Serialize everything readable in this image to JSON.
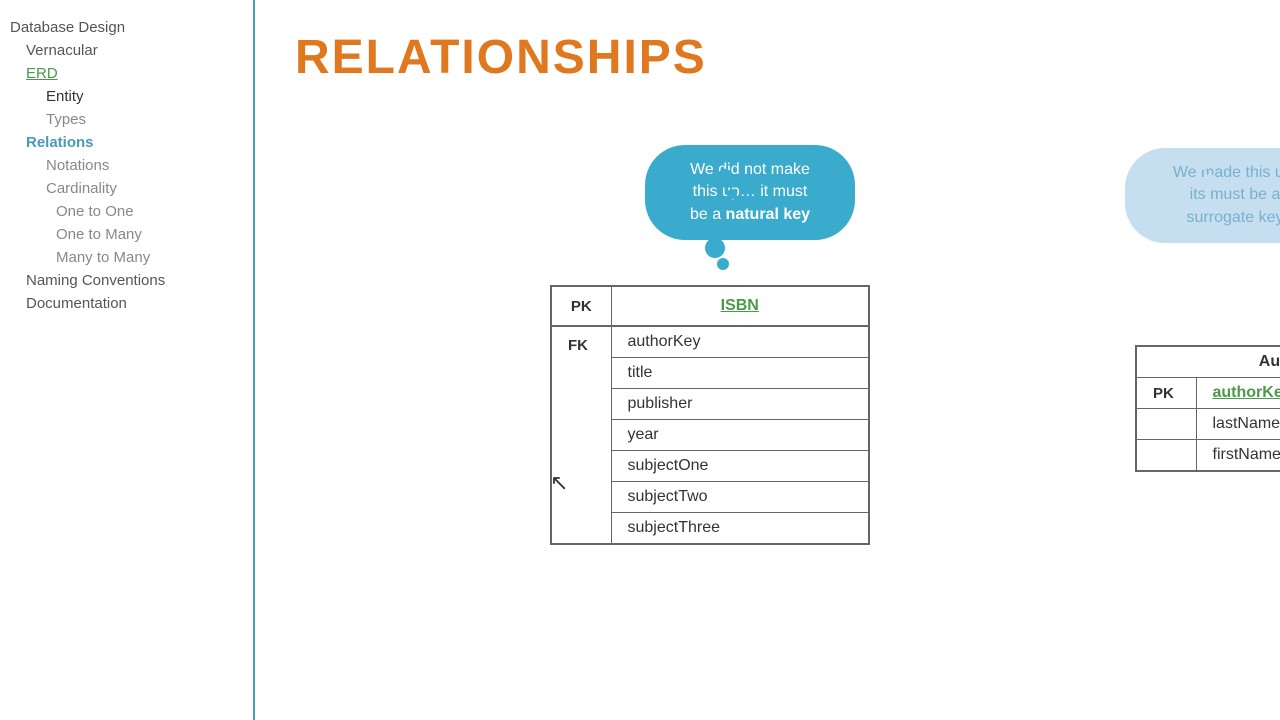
{
  "sidebar": {
    "items": [
      {
        "label": "Database Design",
        "class": "nav-item",
        "indent": 0
      },
      {
        "label": "Vernacular",
        "class": "nav-item indent1",
        "indent": 1
      },
      {
        "label": "ERD",
        "class": "nav-item indent1 green",
        "indent": 1
      },
      {
        "label": "Entity",
        "class": "nav-item indent2 highlight",
        "indent": 2
      },
      {
        "label": "Types",
        "class": "nav-item indent2",
        "indent": 2
      },
      {
        "label": "Relations",
        "class": "nav-item indent1 active",
        "indent": 1
      },
      {
        "label": "Notations",
        "class": "nav-item indent2",
        "indent": 2
      },
      {
        "label": "Cardinality",
        "class": "nav-item indent2",
        "indent": 2
      },
      {
        "label": "One to One",
        "class": "nav-item indent2",
        "indent": 2
      },
      {
        "label": "One to Many",
        "class": "nav-item indent2",
        "indent": 2
      },
      {
        "label": "Many to Many",
        "class": "nav-item indent2",
        "indent": 2
      },
      {
        "label": "Naming Conventions",
        "class": "nav-item indent1",
        "indent": 1
      },
      {
        "label": "Documentation",
        "class": "nav-item indent1",
        "indent": 1
      }
    ]
  },
  "main": {
    "title": "RELATIONSHIPS",
    "thought_bubble_1": {
      "line1": "We did not make",
      "line2": "this up… it must",
      "line3_prefix": "be a ",
      "line3_key": "natural key"
    },
    "thought_bubble_2": {
      "line1": "We made this up,",
      "line2": "its must be a",
      "line3": "surrogate key"
    },
    "book_table": {
      "pk_label": "PK",
      "pk_value": "ISBN",
      "fk_label": "FK",
      "fields": [
        "authorKey",
        "title",
        "publisher",
        "year",
        "subjectOne",
        "subjectTwo",
        "subjectThree"
      ]
    },
    "author_table": {
      "header": "Author",
      "pk_label": "PK",
      "pk_value": "authorKey",
      "fields": [
        "lastName",
        "firstName"
      ]
    }
  },
  "icons": {
    "cursor": "↖"
  }
}
